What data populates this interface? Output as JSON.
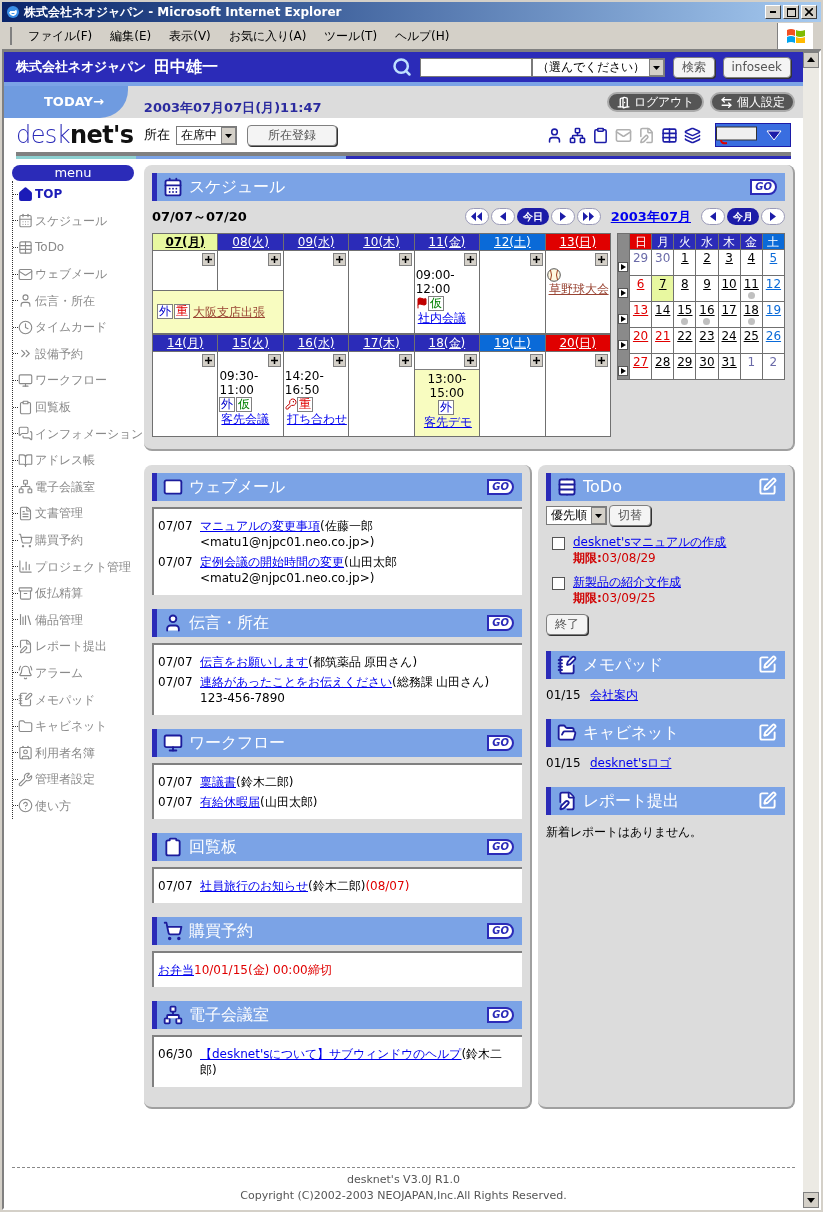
{
  "window": {
    "title": "株式会社ネオジャパン - Microsoft Internet Explorer"
  },
  "menu_bar": [
    "ファイル(F)",
    "編集(E)",
    "表示(V)",
    "お気に入り(A)",
    "ツール(T)",
    "ヘルプ(H)"
  ],
  "header": {
    "company": "株式会社ネオジャパン",
    "user": "田中雄一",
    "search_select": "（選んでください）",
    "buttons": [
      "検索",
      "infoseek"
    ]
  },
  "today_bar": {
    "label": "TODAY→",
    "datetime": "2003年07月07日(月)11:47",
    "buttons": [
      "ログアウト",
      "個人設定"
    ]
  },
  "toolbar": {
    "logo": [
      "desk",
      "net's"
    ],
    "status_label": "所在",
    "status_value": "在席中",
    "register_button": "所在登録"
  },
  "sidebar": {
    "title": "menu",
    "items": [
      {
        "label": "TOP",
        "selected": true
      },
      {
        "label": "スケジュール",
        "selected": false
      },
      {
        "label": "ToDo",
        "selected": false
      },
      {
        "label": "ウェブメール",
        "selected": false
      },
      {
        "label": "伝言・所在",
        "selected": false
      },
      {
        "label": "タイムカード",
        "selected": false
      },
      {
        "label": "設備予約",
        "selected": false
      },
      {
        "label": "ワークフロー",
        "selected": false
      },
      {
        "label": "回覧板",
        "selected": false
      },
      {
        "label": "インフォメーション",
        "selected": false
      },
      {
        "label": "アドレス帳",
        "selected": false
      },
      {
        "label": "電子会議室",
        "selected": false
      },
      {
        "label": "文書管理",
        "selected": false
      },
      {
        "label": "購買予約",
        "selected": false
      },
      {
        "label": "プロジェクト管理",
        "selected": false
      },
      {
        "label": "仮払精算",
        "selected": false
      },
      {
        "label": "備品管理",
        "selected": false
      },
      {
        "label": "レポート提出",
        "selected": false
      },
      {
        "label": "アラーム",
        "selected": false
      },
      {
        "label": "メモパッド",
        "selected": false
      },
      {
        "label": "キャビネット",
        "selected": false
      },
      {
        "label": "利用者名簿",
        "selected": false
      },
      {
        "label": "管理者設定",
        "selected": false
      },
      {
        "label": "使い方",
        "selected": false
      }
    ]
  },
  "schedule": {
    "title": "スケジュール",
    "action": "GO",
    "range": "07/07～07/20",
    "today_button": "今日",
    "month": "2003年07月",
    "this_month_button": "今月",
    "weeks": [
      {
        "days": [
          {
            "label": "07(月)",
            "kind": "weekday",
            "selected": true,
            "all_day_event": {
              "tags": [
                {
                  "text": "外",
                  "kind": "out"
                },
                {
                  "text": "重",
                  "kind": "important"
                }
              ],
              "title": "大阪支店出張",
              "color": "#994433"
            }
          },
          {
            "label": "08(火)",
            "kind": "weekday",
            "selected": false,
            "all_day_continued": true
          },
          {
            "label": "09(水)",
            "kind": "weekday",
            "selected": false
          },
          {
            "label": "10(木)",
            "kind": "weekday",
            "selected": false
          },
          {
            "label": "11(金)",
            "kind": "weekday",
            "selected": false,
            "events": [
              {
                "time": "09:00-12:00",
                "kind": "flag",
                "tags": [
                  {
                    "text": "仮",
                    "kind": "tentative"
                  }
                ],
                "title": "社内会議",
                "color": "#0000ee",
                "highlight": false
              }
            ]
          },
          {
            "label": "12(土)",
            "kind": "sat",
            "selected": false
          },
          {
            "label": "13(日)",
            "kind": "sun",
            "selected": false,
            "events": [
              {
                "kind": "ball",
                "title": "草野球大会",
                "color": "#994433",
                "highlight": false
              }
            ]
          }
        ]
      },
      {
        "days": [
          {
            "label": "14(月)",
            "kind": "weekday",
            "selected": false
          },
          {
            "label": "15(火)",
            "kind": "weekday",
            "selected": false,
            "events": [
              {
                "time": "09:30-11:00",
                "kind": "plain",
                "tags": [
                  {
                    "text": "外",
                    "kind": "out"
                  },
                  {
                    "text": "仮",
                    "kind": "tentative"
                  }
                ],
                "title": "客先会議",
                "color": "#0000ee",
                "highlight": false
              }
            ]
          },
          {
            "label": "16(水)",
            "kind": "weekday",
            "selected": false,
            "events": [
              {
                "time": "14:20-16:50",
                "kind": "key",
                "tags": [
                  {
                    "text": "重",
                    "kind": "important"
                  }
                ],
                "title": "打ち合わせ",
                "color": "#0000ee",
                "highlight": false
              }
            ]
          },
          {
            "label": "17(木)",
            "kind": "weekday",
            "selected": false
          },
          {
            "label": "18(金)",
            "kind": "weekday",
            "selected": false,
            "events": [
              {
                "time": "13:00-15:00",
                "kind": "plain",
                "tags": [
                  {
                    "text": "外",
                    "kind": "out"
                  }
                ],
                "title": "客先デモ",
                "color": "#0000ee",
                "highlight": true
              }
            ]
          },
          {
            "label": "19(土)",
            "kind": "sat",
            "selected": false
          },
          {
            "label": "20(日)",
            "kind": "sun",
            "selected": false
          }
        ]
      }
    ],
    "mini_calendar": {
      "weekdays": [
        {
          "label": "日",
          "kind": "sun"
        },
        {
          "label": "月",
          "kind": "weekday"
        },
        {
          "label": "火",
          "kind": "weekday"
        },
        {
          "label": "水",
          "kind": "weekday"
        },
        {
          "label": "木",
          "kind": "weekday"
        },
        {
          "label": "金",
          "kind": "weekday"
        },
        {
          "label": "土",
          "kind": "sat"
        }
      ],
      "weeks": [
        [
          {
            "label": "29",
            "kind": "other",
            "selected": false,
            "marked": false
          },
          {
            "label": "30",
            "kind": "other",
            "selected": false,
            "marked": false
          },
          {
            "label": "1",
            "kind": "weekday",
            "selected": false,
            "marked": false
          },
          {
            "label": "2",
            "kind": "weekday",
            "selected": false,
            "marked": false
          },
          {
            "label": "3",
            "kind": "weekday",
            "selected": false,
            "marked": false
          },
          {
            "label": "4",
            "kind": "weekday",
            "selected": false,
            "marked": false
          },
          {
            "label": "5",
            "kind": "sat",
            "selected": false,
            "marked": false
          }
        ],
        [
          {
            "label": "6",
            "kind": "sun",
            "selected": false,
            "marked": false
          },
          {
            "label": "7",
            "kind": "weekday",
            "selected": true,
            "marked": false
          },
          {
            "label": "8",
            "kind": "weekday",
            "selected": false,
            "marked": false
          },
          {
            "label": "9",
            "kind": "weekday",
            "selected": false,
            "marked": false
          },
          {
            "label": "10",
            "kind": "weekday",
            "selected": false,
            "marked": false
          },
          {
            "label": "11",
            "kind": "weekday",
            "selected": false,
            "marked": true
          },
          {
            "label": "12",
            "kind": "sat",
            "selected": false,
            "marked": false
          }
        ],
        [
          {
            "label": "13",
            "kind": "sun",
            "selected": false,
            "marked": false
          },
          {
            "label": "14",
            "kind": "weekday",
            "selected": false,
            "marked": false
          },
          {
            "label": "15",
            "kind": "weekday",
            "selected": false,
            "marked": true
          },
          {
            "label": "16",
            "kind": "weekday",
            "selected": false,
            "marked": true
          },
          {
            "label": "17",
            "kind": "weekday",
            "selected": false,
            "marked": false
          },
          {
            "label": "18",
            "kind": "weekday",
            "selected": false,
            "marked": true
          },
          {
            "label": "19",
            "kind": "sat",
            "selected": false,
            "marked": false
          }
        ],
        [
          {
            "label": "20",
            "kind": "sun",
            "selected": false,
            "marked": false
          },
          {
            "label": "21",
            "kind": "holiday",
            "selected": false,
            "marked": false
          },
          {
            "label": "22",
            "kind": "weekday",
            "selected": false,
            "marked": false
          },
          {
            "label": "23",
            "kind": "weekday",
            "selected": false,
            "marked": false
          },
          {
            "label": "24",
            "kind": "weekday",
            "selected": false,
            "marked": false
          },
          {
            "label": "25",
            "kind": "weekday",
            "selected": false,
            "marked": false
          },
          {
            "label": "26",
            "kind": "sat",
            "selected": false,
            "marked": false
          }
        ],
        [
          {
            "label": "27",
            "kind": "sun",
            "selected": false,
            "marked": false
          },
          {
            "label": "28",
            "kind": "weekday",
            "selected": false,
            "marked": false
          },
          {
            "label": "29",
            "kind": "weekday",
            "selected": false,
            "marked": false
          },
          {
            "label": "30",
            "kind": "weekday",
            "selected": false,
            "marked": false
          },
          {
            "label": "31",
            "kind": "weekday",
            "selected": false,
            "marked": false
          },
          {
            "label": "1",
            "kind": "other",
            "selected": false,
            "marked": false
          },
          {
            "label": "2",
            "kind": "other",
            "selected": false,
            "marked": false
          }
        ]
      ]
    }
  },
  "left_panels": [
    {
      "kind": "webmail",
      "title": "ウェブメール",
      "action": "GO",
      "items": [
        {
          "date": "07/07",
          "link": "マニュアルの変更事項",
          "note": "(佐藤一郎<matu1@njpc01.neo.co.jp>)"
        },
        {
          "date": "07/07",
          "link": "定例会議の開始時間の変更",
          "note": "(山田太郎<matu2@njpc01.neo.co.jp>)"
        }
      ]
    },
    {
      "kind": "message",
      "title": "伝言・所在",
      "action": "GO",
      "items": [
        {
          "date": "07/07",
          "link": "伝言をお願いします",
          "note": "(都筑薬品 原田さん)"
        },
        {
          "date": "07/07",
          "link": "連絡があったことをお伝えください",
          "note": "(総務課 山田さん) 123-456-7890"
        }
      ]
    },
    {
      "kind": "workflow",
      "title": "ワークフロー",
      "action": "GO",
      "items": [
        {
          "date": "07/07",
          "link": "稟議書",
          "note": "(鈴木二郎)"
        },
        {
          "date": "07/07",
          "link": "有給休暇届",
          "note": "(山田太郎)"
        }
      ]
    },
    {
      "kind": "circular",
      "title": "回覧板",
      "action": "GO",
      "items": [
        {
          "date": "07/07",
          "link": "社員旅行のお知らせ",
          "note": "(鈴木二郎)",
          "due": "(08/07)"
        }
      ]
    },
    {
      "kind": "purchase",
      "title": "購買予約",
      "action": "GO",
      "items": [
        {
          "link": "お弁当",
          "due": "10/01/15(金) 00:00締切"
        }
      ]
    },
    {
      "kind": "conference",
      "title": "電子会議室",
      "action": "GO",
      "items": [
        {
          "date": "06/30",
          "link": "【desknet'sについて】サブウィンドウのヘルプ",
          "note": "(鈴木二郎)"
        }
      ]
    }
  ],
  "todo": {
    "title": "ToDo",
    "sort_select": "優先順",
    "switch_button": "切替",
    "items": [
      {
        "title": "desknet'sマニュアルの作成",
        "due": "**期限:**03/08/29",
        "checked": false
      },
      {
        "title": "新製品の紹介文作成",
        "due": "**期限:**03/09/25",
        "checked": false
      }
    ],
    "finish_button": "終了"
  },
  "right_panels": [
    {
      "kind": "memo",
      "title": "メモパッド",
      "items": [
        {
          "date": "01/15",
          "link": "会社案内"
        }
      ]
    },
    {
      "kind": "cabinet",
      "title": "キャビネット",
      "items": [
        {
          "date": "01/15",
          "link": "desknet'sロゴ"
        }
      ]
    },
    {
      "kind": "report",
      "title": "レポート提出",
      "message": "新着レポートはありません。"
    }
  ],
  "footer": {
    "version": "desknet's V3.0J R1.0",
    "copyright": "Copyright (C)2002-2003 NEOJAPAN,Inc.All Rights Reserved."
  }
}
